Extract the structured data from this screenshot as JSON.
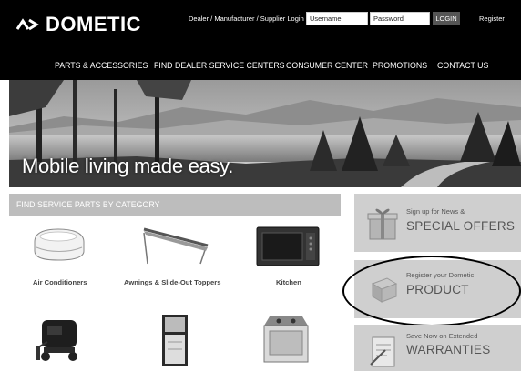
{
  "header": {
    "brand": "DOMETIC",
    "login_label": "Dealer / Manufacturer / Supplier Login",
    "username_value": "Username",
    "password_value": "Password",
    "login_button": "LOGIN",
    "register_link": "Register"
  },
  "nav": {
    "items": [
      "PARTS & ACCESSORIES",
      "FIND DEALER SERVICE CENTERS",
      "CONSUMER CENTER",
      "PROMOTIONS",
      "CONTACT US"
    ]
  },
  "hero": {
    "tagline": "Mobile living made easy."
  },
  "categories": {
    "header": "FIND SERVICE PARTS BY CATEGORY",
    "items": [
      {
        "label": "Air Conditioners",
        "icon": "air-conditioner-icon"
      },
      {
        "label": "Awnings & Slide-Out Toppers",
        "icon": "awning-icon"
      },
      {
        "label": "Kitchen",
        "icon": "microwave-icon"
      },
      {
        "label": "",
        "icon": "generator-icon"
      },
      {
        "label": "",
        "icon": "refrigerator-icon"
      },
      {
        "label": "",
        "icon": "cooktop-icon"
      }
    ]
  },
  "promos": [
    {
      "small": "Sign up for News &",
      "big": "SPECIAL OFFERS",
      "icon": "gift-icon"
    },
    {
      "small": "Register your Dometic",
      "big": "PRODUCT",
      "icon": "box-icon"
    },
    {
      "small": "Save Now on Extended",
      "big": "WARRANTIES",
      "icon": "warranty-document-icon"
    }
  ]
}
